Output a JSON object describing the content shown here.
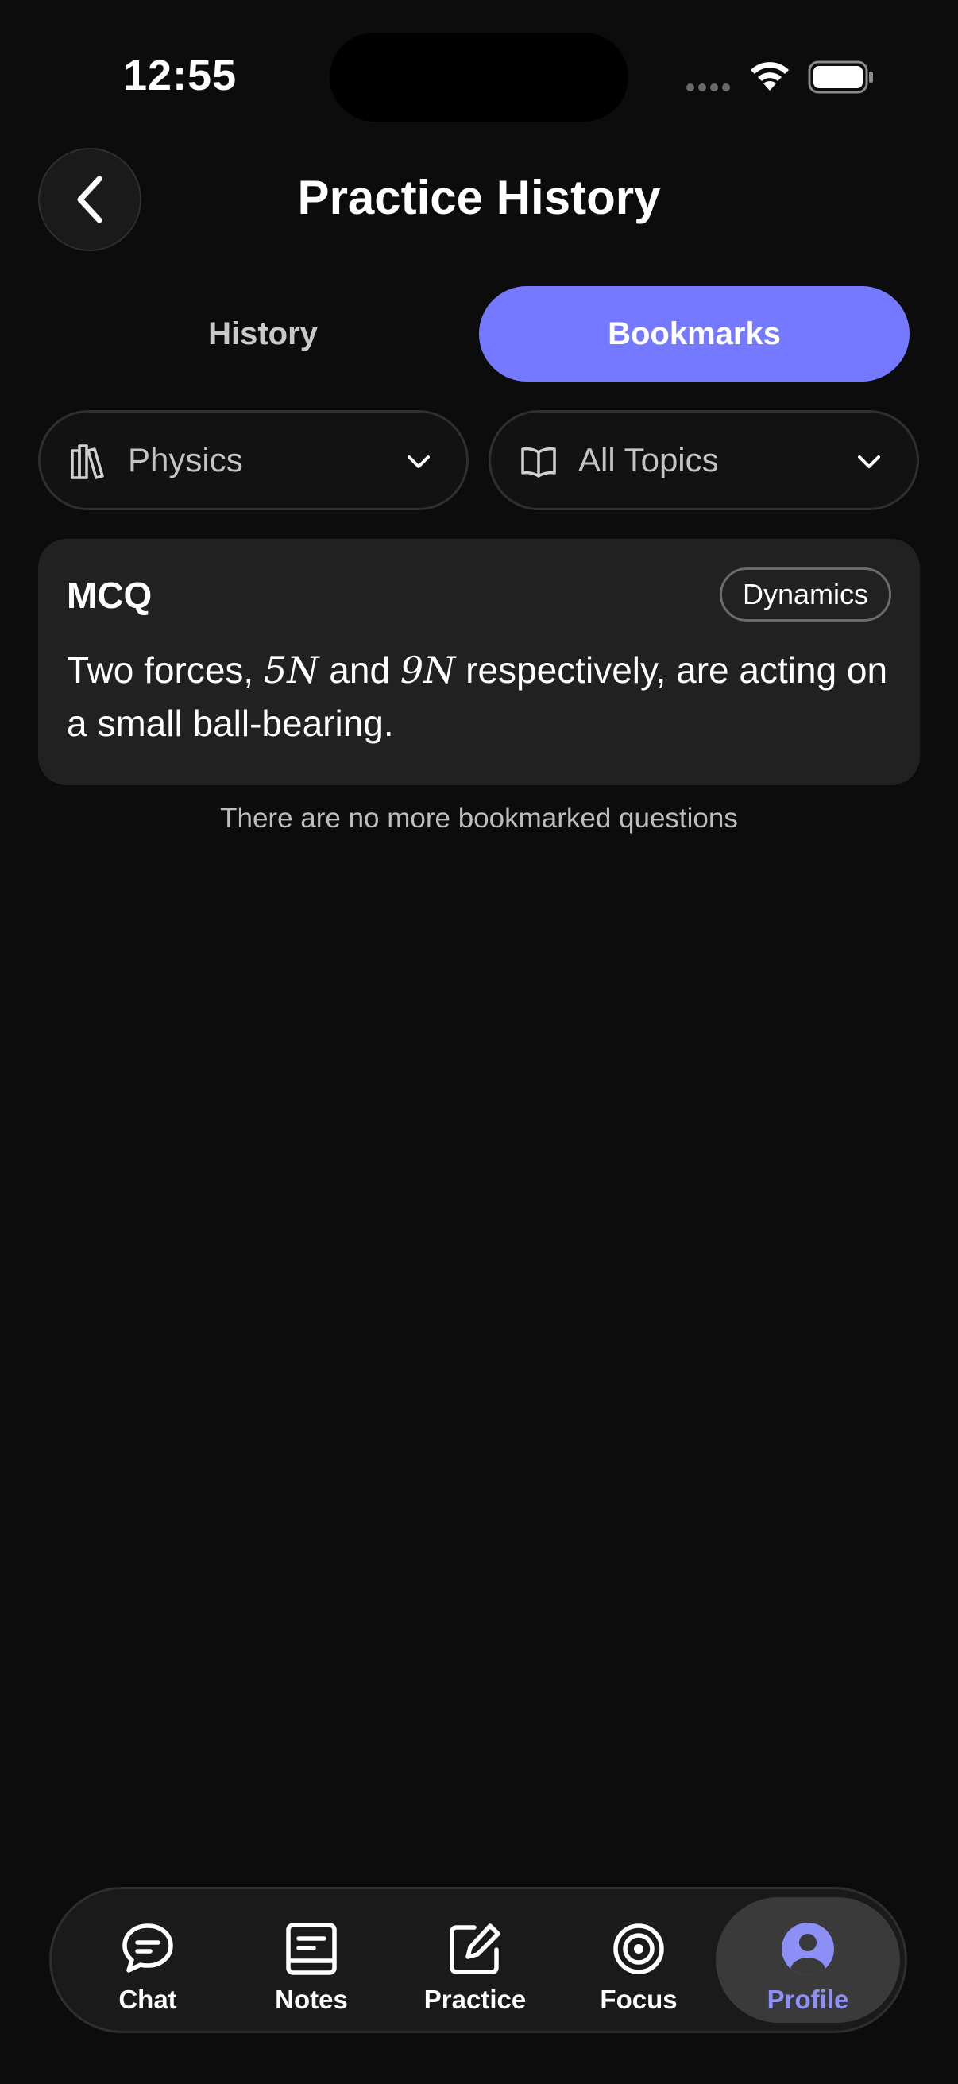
{
  "status_bar": {
    "time": "12:55"
  },
  "header": {
    "title": "Practice History",
    "back_icon": "chevron-left-icon"
  },
  "tabs": [
    {
      "label": "History",
      "active": false
    },
    {
      "label": "Bookmarks",
      "active": true
    }
  ],
  "filters": {
    "subject": {
      "label": "Physics",
      "icon": "books-icon"
    },
    "topic": {
      "label": "All Topics",
      "icon": "open-book-icon"
    }
  },
  "question": {
    "type": "MCQ",
    "topic": "Dynamics",
    "text_part1": "Two forces, ",
    "math1": "5N",
    "text_part2": " and ",
    "math2": "9N",
    "text_part3": " respectively, are acting on a small ball-bearing."
  },
  "empty_message": "There are no more bookmarked questions",
  "bottom_nav": {
    "items": [
      {
        "label": "Chat",
        "icon": "chat-icon"
      },
      {
        "label": "Notes",
        "icon": "notes-icon"
      },
      {
        "label": "Practice",
        "icon": "practice-icon"
      },
      {
        "label": "Focus",
        "icon": "target-icon"
      },
      {
        "label": "Profile",
        "icon": "profile-icon",
        "active": true
      }
    ]
  },
  "colors": {
    "accent": "#7579ff",
    "background": "#0c0c0c",
    "card": "#212121",
    "active_nav_label": "#8c8ff5"
  }
}
